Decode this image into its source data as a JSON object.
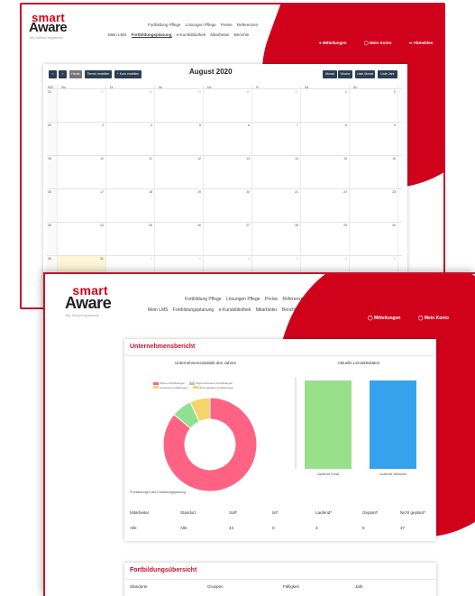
{
  "brand": {
    "smart": "smart",
    "aware": "Aware",
    "tagline": "My School organizes",
    "accent": "#d0021b"
  },
  "nav_top": {
    "items": [
      "Fortbildung Pflege",
      "Lösungen Pflege",
      "Preise",
      "Referenzen"
    ]
  },
  "nav_main": {
    "items": [
      "Mein LMS",
      "Fortbildungsplanung",
      "e-Kursbibliothek",
      "Mitarbeiter",
      "Berichte"
    ],
    "active": "Fortbildungsplanung"
  },
  "user_menu": {
    "items": [
      "Mitteilungen",
      "Mein Konto",
      "Abmelden"
    ]
  },
  "calendar": {
    "nav_prev": "<",
    "nav_next": ">",
    "today_label": "Heute",
    "add_event_label": "Termin erstellen",
    "add_course_label": "+ Kurs erstellen",
    "title": "August 2020",
    "view_buttons": [
      "Monat",
      "Woche",
      "Liste Monat",
      "Liste Jahr"
    ],
    "weekdays": [
      "KW",
      "Mo",
      "Di",
      "Mi",
      "Do",
      "Fr",
      "Sa",
      "So"
    ],
    "weeks": [
      {
        "kw": "31",
        "days": [
          "27",
          "28",
          "29",
          "30",
          "31",
          "1",
          "2"
        ]
      },
      {
        "kw": "32",
        "days": [
          "3",
          "4",
          "5",
          "6",
          "7",
          "8",
          "9"
        ]
      },
      {
        "kw": "33",
        "days": [
          "10",
          "11",
          "12",
          "13",
          "14",
          "15",
          "16"
        ]
      },
      {
        "kw": "34",
        "days": [
          "17",
          "18",
          "19",
          "20",
          "21",
          "22",
          "23"
        ]
      },
      {
        "kw": "35",
        "days": [
          "24",
          "25",
          "26",
          "27",
          "28",
          "29",
          "30"
        ]
      },
      {
        "kw": "36",
        "days": [
          "31",
          "1",
          "2",
          "3",
          "4",
          "5",
          "6"
        ]
      }
    ]
  },
  "report": {
    "title": "Unternehmensbericht",
    "donut_title": "Unternehmensstatistik des Jahres",
    "bars_title": "Aktuelle Lernaktivitäten",
    "legend": [
      {
        "label": "Offene Fortbildungen",
        "color": "#ff6384"
      },
      {
        "label": "Abgeschlossene Fortbildungen",
        "color": "#8fe08f"
      },
      {
        "label": "Laufende Fortbildungen",
        "color": "#f7d46b"
      },
      {
        "label": "Nicht geplante Fortbildungen",
        "color": "#f7d46b"
      }
    ],
    "bars": [
      {
        "label": "Laufende Kurse",
        "value": 1,
        "color": "#98e08a"
      },
      {
        "label": "Laufende Webinare",
        "value": 1,
        "color": "#36a2eb"
      }
    ],
    "footnote": "*Fortbildungen laut Fortbildungsplanung",
    "table": {
      "headers": [
        "Mitarbeiter",
        "Standort",
        "Soll*",
        "Ist*",
        "Laufend*",
        "Geplant*",
        "Nicht geplant*"
      ],
      "values": [
        "Alle",
        "Alle",
        "43",
        "0",
        "3",
        "6",
        "37"
      ]
    }
  },
  "overview": {
    "title": "Fortbildungsübersicht",
    "headers": [
      "Standorte",
      "Gruppen",
      "Fälligkeit",
      "Jahr"
    ]
  },
  "chart_data": [
    {
      "type": "pie",
      "title": "Unternehmensstatistik des Jahres",
      "categories": [
        "Offene Fortbildungen",
        "Abgeschlossene Fortbildungen",
        "Laufende Fortbildungen",
        "Nicht geplante Fortbildungen"
      ],
      "values": [
        37,
        3,
        3,
        0
      ]
    },
    {
      "type": "bar",
      "title": "Aktuelle Lernaktivitäten",
      "categories": [
        "Laufende Kurse",
        "Laufende Webinare"
      ],
      "values": [
        1,
        1
      ],
      "ylim": [
        0,
        1
      ]
    }
  ]
}
